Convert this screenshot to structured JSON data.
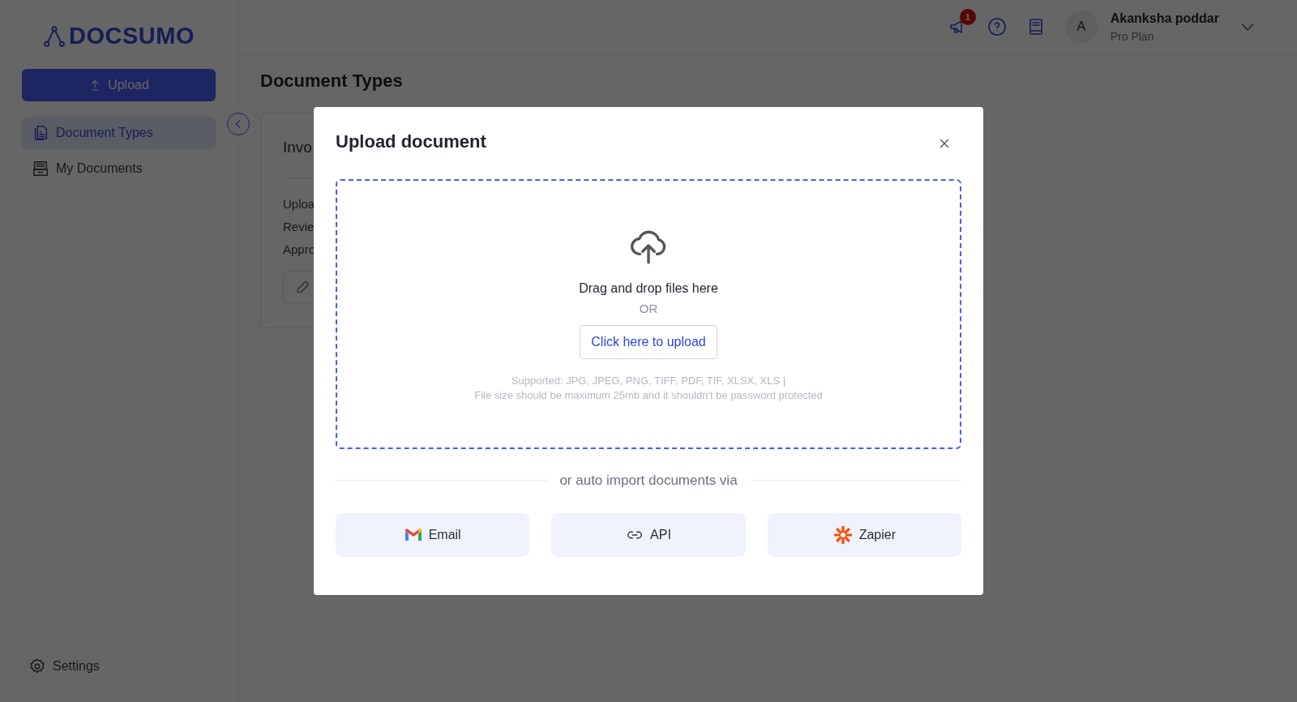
{
  "sidebar": {
    "logo": "DOCSUMO",
    "upload_button": "Upload",
    "items": [
      {
        "kind": "types",
        "label": "Document Types",
        "selected": true
      },
      {
        "kind": "docs",
        "label": "My Documents",
        "selected": false
      }
    ],
    "settings": "Settings"
  },
  "header": {
    "notification_count": "1",
    "user": {
      "avatar": "A",
      "name": "Akanksha poddar",
      "plan": "Pro Plan"
    }
  },
  "page": {
    "title": "Document Types",
    "card": {
      "title": "Invo",
      "lines": [
        "Uploa",
        "Revie",
        "Appro"
      ]
    }
  },
  "modal": {
    "title": "Upload document",
    "dropzone": {
      "prompt": "Drag and drop files here",
      "or": "OR",
      "button": "Click here to upload",
      "supported": "Supported: JPG, JPEG, PNG, TIFF, PDF, TIF, XLSX, XLS |",
      "limit": "File size should be maximum 25mb and it shouldn't be password protected"
    },
    "divider": "or auto import documents via",
    "imports": [
      {
        "kind": "email",
        "label": "Email"
      },
      {
        "kind": "api",
        "label": "API"
      },
      {
        "kind": "zapier",
        "label": "Zapier"
      }
    ]
  }
}
